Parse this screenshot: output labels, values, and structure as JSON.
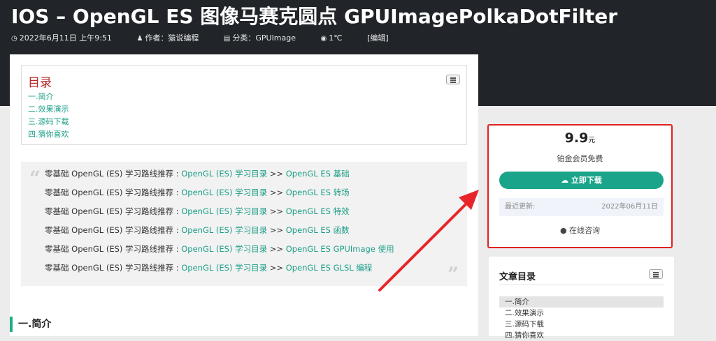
{
  "post": {
    "title": "IOS  –  OpenGL ES 图像马赛克圆点 GPUImagePolkaDotFilter",
    "date": "2022年6月11日 上午9:51",
    "author": "作者：猿说编程",
    "category": "分类：GPUImage",
    "temperature": "1℃",
    "edit": "[编辑]"
  },
  "toc": {
    "title": "目录",
    "items": [
      "一.简介",
      "二.效果演示",
      "三.源码下载",
      "四.猜你喜欢"
    ]
  },
  "quote": {
    "lines": [
      {
        "prefix": "零基础 OpenGL (ES) 学习路线推荐 : ",
        "link1": "OpenGL (ES) 学习目录",
        "sep": " >> ",
        "link2": "OpenGL ES 基础"
      },
      {
        "prefix": "零基础 OpenGL (ES) 学习路线推荐 : ",
        "link1": "OpenGL (ES) 学习目录",
        "sep": " >> ",
        "link2": "OpenGL ES 转场"
      },
      {
        "prefix": "零基础 OpenGL (ES) 学习路线推荐 : ",
        "link1": "OpenGL (ES) 学习目录",
        "sep": " >> ",
        "link2": "OpenGL ES 特效"
      },
      {
        "prefix": "零基础 OpenGL (ES) 学习路线推荐 : ",
        "link1": "OpenGL (ES) 学习目录",
        "sep": " >> ",
        "link2": "OpenGL ES 函数"
      },
      {
        "prefix": "零基础 OpenGL (ES) 学习路线推荐 : ",
        "link1": "OpenGL (ES) 学习目录",
        "sep": " >> ",
        "link2": "OpenGL ES GPUImage 使用"
      },
      {
        "prefix": "零基础 OpenGL (ES) 学习路线推荐 : ",
        "link1": "OpenGL (ES) 学习目录",
        "sep": " >> ",
        "link2": "OpenGL ES GLSL 编程"
      }
    ]
  },
  "section_heading": "一.简介",
  "download_box": {
    "price": "9.9",
    "currency": "元",
    "free_note": "铂金会员免费",
    "download_label": "立即下载",
    "update_label": "最近更新:",
    "update_date": "2022年06月11日",
    "consult_label": "在线咨询"
  },
  "sidebar_toc": {
    "title": "文章目录",
    "items": [
      "一.简介",
      "二.效果演示",
      "三.源码下载",
      "四.猜你喜欢"
    ]
  },
  "colors": {
    "accent": "#1aa58a",
    "header_bg": "#212529",
    "highlight_border": "#e02020",
    "arrow": "#e8262a",
    "toc_title": "#b8282a"
  },
  "icons": [
    "clock-icon",
    "user-icon",
    "folder-icon",
    "eye-icon",
    "list-toggle-icon",
    "quote-open-icon",
    "quote-close-icon",
    "cloud-download-icon",
    "chat-icon",
    "red-arrow-annotation"
  ]
}
